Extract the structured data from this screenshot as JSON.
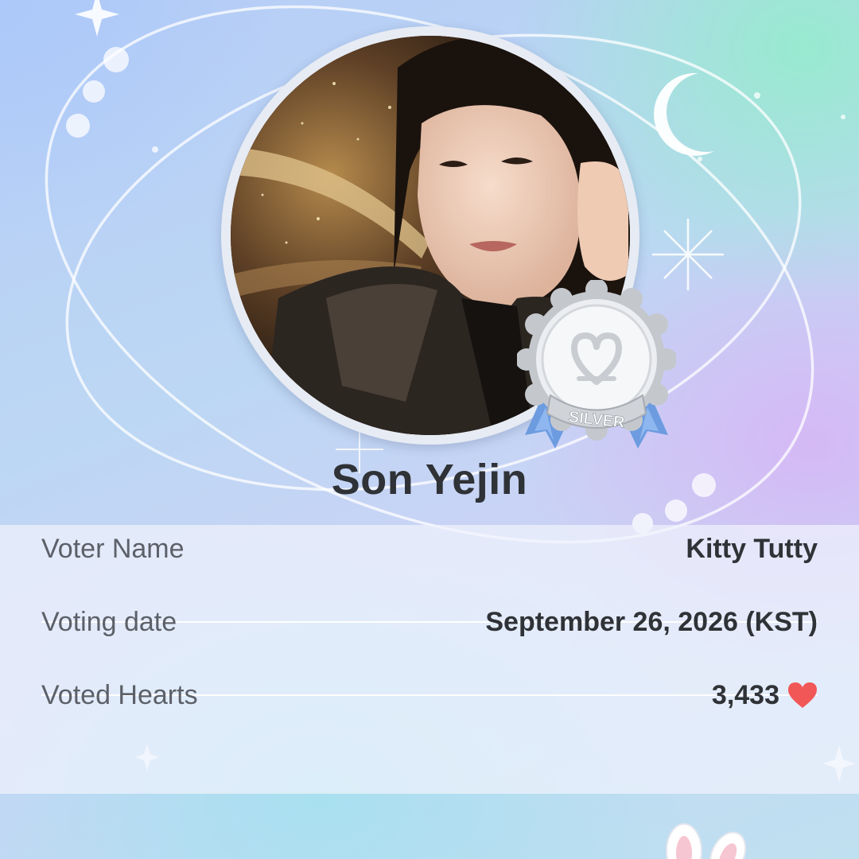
{
  "card": {
    "idol_name": "Son Yejin",
    "badge_label": "SILVER"
  },
  "vote_details": {
    "voter_name_label": "Voter Name",
    "voter_name_value": "Kitty Tutty",
    "voting_date_label": "Voting date",
    "voting_date_value": "September 26, 2026 (KST)",
    "voted_hearts_label": "Voted Hearts",
    "voted_hearts_value": "3,433"
  },
  "icons": {
    "heart": "heart-icon",
    "moon": "crescent-moon-icon",
    "sparkle": "sparkle-icon",
    "badge": "silver-medal-icon",
    "logo_mark": "double-heart-logo-icon"
  },
  "colors": {
    "heart": "#f25757",
    "text_dark": "#2f3236",
    "text_label": "#5c6068",
    "badge_ribbon": "#6c9be0",
    "badge_silver": "#c4c8cd"
  }
}
